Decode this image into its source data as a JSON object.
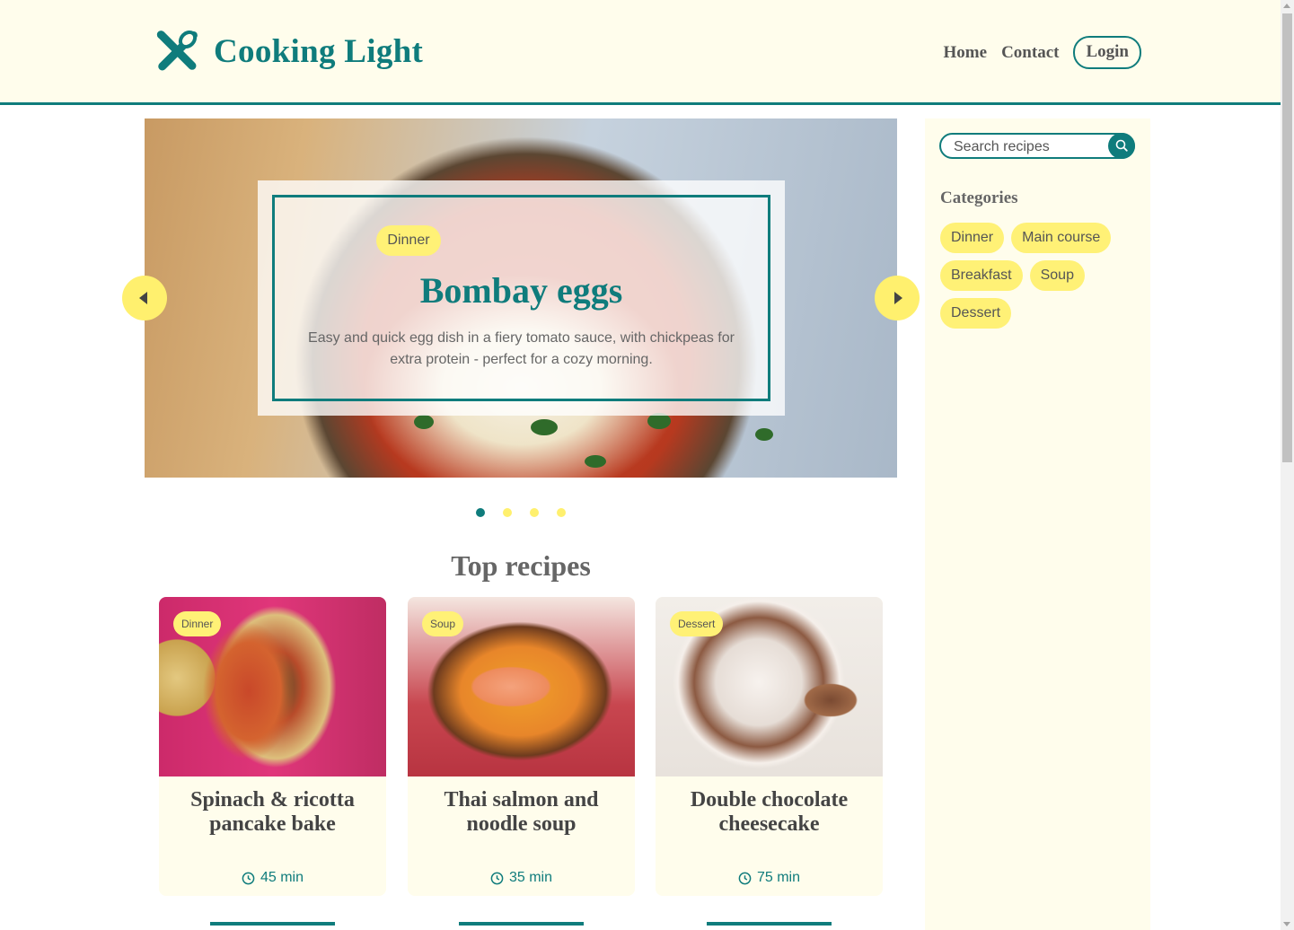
{
  "header": {
    "logo_icon": "utensils-icon",
    "title": "Cooking Light",
    "nav": {
      "home": "Home",
      "contact": "Contact",
      "login": "Login"
    }
  },
  "hero": {
    "tag": "Dinner",
    "title": "Bombay eggs",
    "description": "Easy and quick egg dish in a fiery tomato sauce, with chickpeas for extra protein - perfect for a cozy morning.",
    "prev_icon": "chevron-left-icon",
    "next_icon": "chevron-right-icon",
    "slides": 4,
    "active_slide": 1
  },
  "top_recipes": {
    "title": "Top recipes",
    "cards": [
      {
        "tag": "Dinner",
        "title": "Spinach & ricotta pancake bake",
        "time": "45 min"
      },
      {
        "tag": "Soup",
        "title": "Thai salmon and noodle soup",
        "time": "35 min"
      },
      {
        "tag": "Dessert",
        "title": "Double chocolate cheesecake",
        "time": "75 min"
      }
    ]
  },
  "sidebar": {
    "search": {
      "placeholder": "Search recipes",
      "icon": "search-icon"
    },
    "categories_title": "Categories",
    "categories": [
      "Dinner",
      "Main course",
      "Breakfast",
      "Soup",
      "Dessert"
    ]
  },
  "colors": {
    "accent": "#0f7c7c",
    "highlight": "#fff176",
    "background_cream": "#fffdec"
  }
}
